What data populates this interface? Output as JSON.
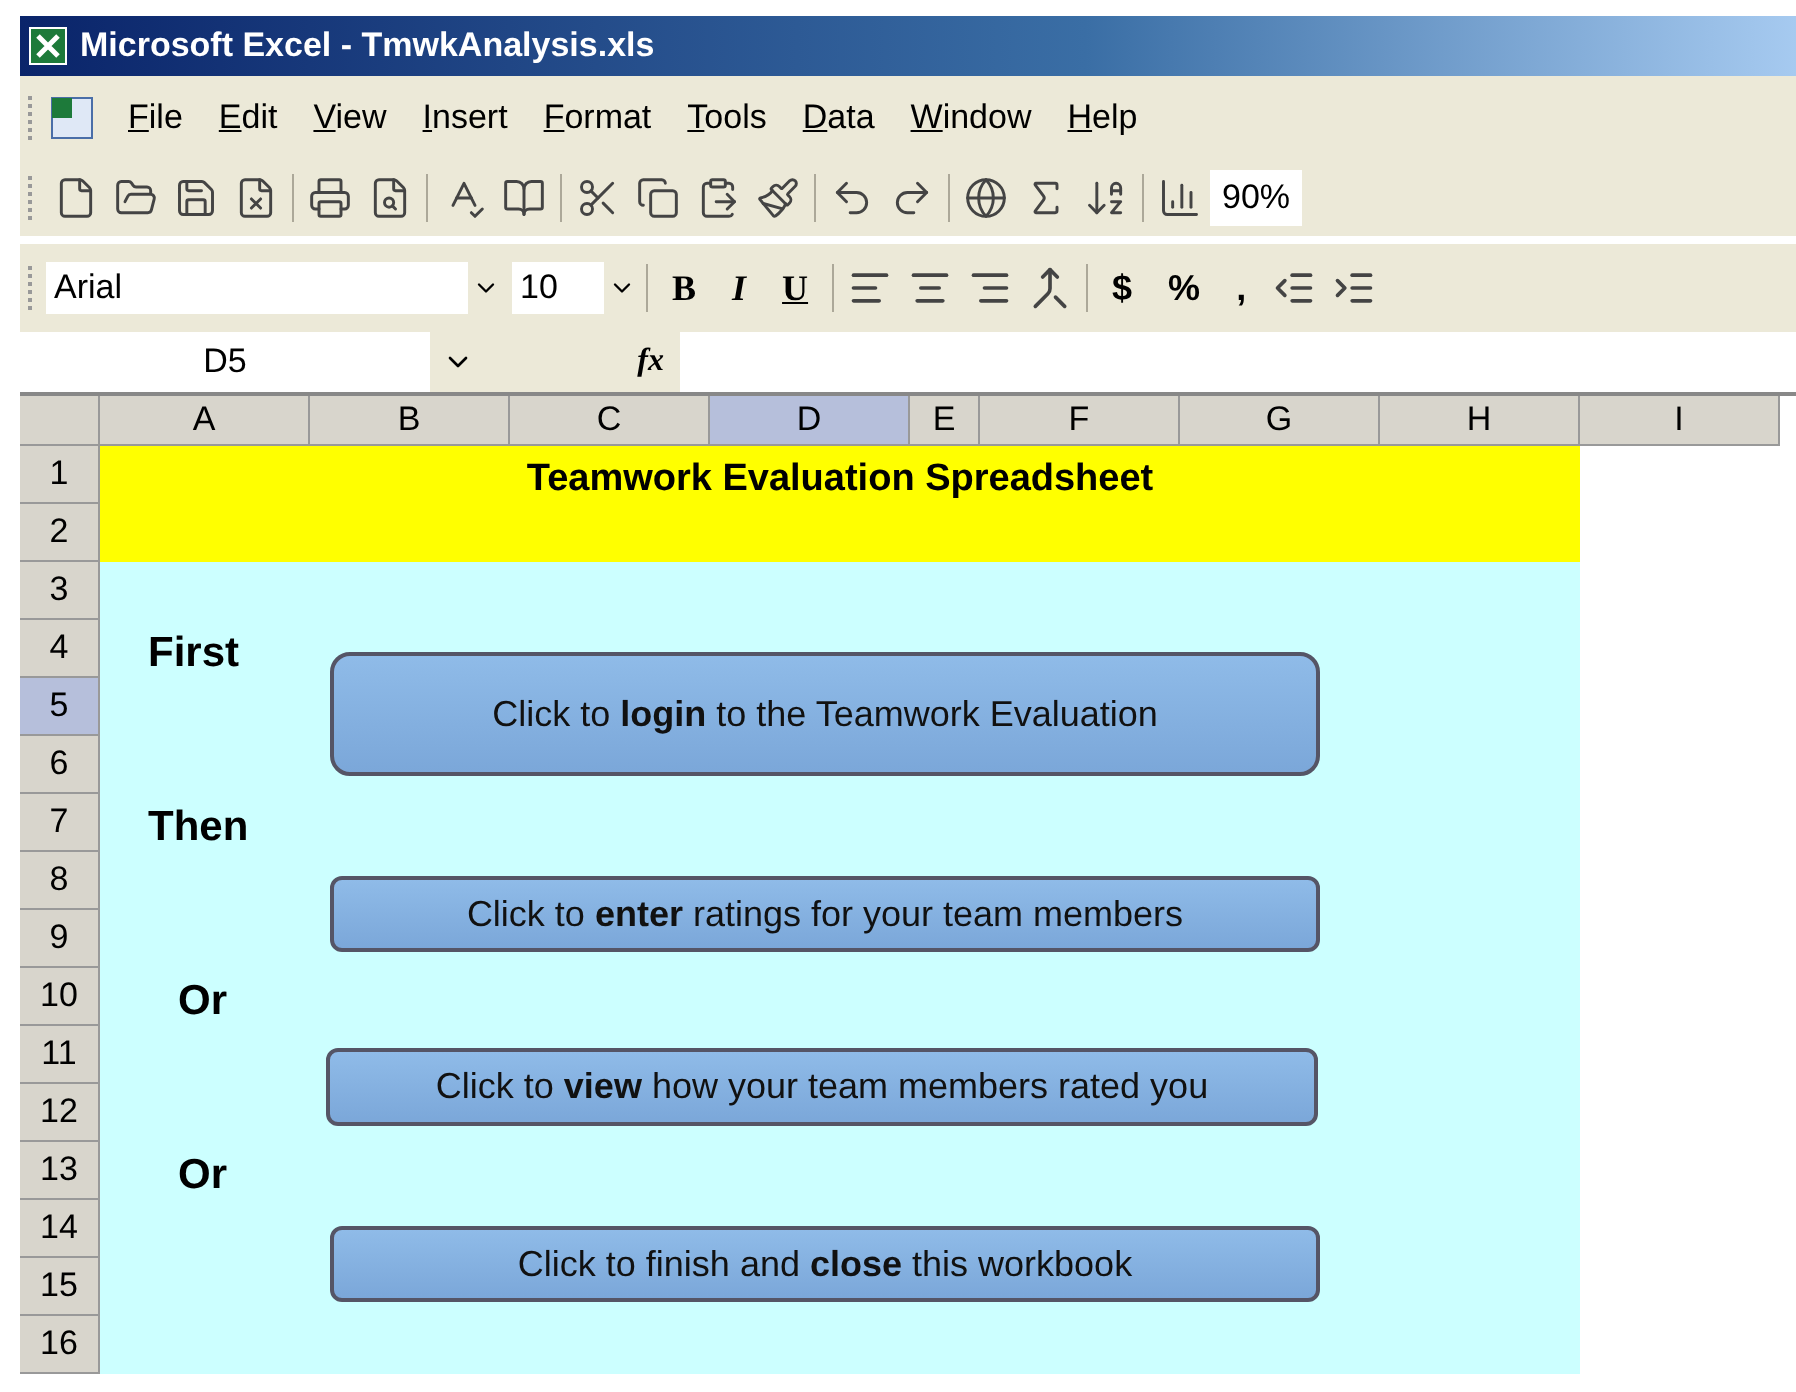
{
  "window": {
    "title": "Microsoft Excel - TmwkAnalysis.xls"
  },
  "menu": [
    {
      "label": "File"
    },
    {
      "label": "Edit"
    },
    {
      "label": "View"
    },
    {
      "label": "Insert"
    },
    {
      "label": "Format"
    },
    {
      "label": "Tools"
    },
    {
      "label": "Data"
    },
    {
      "label": "Window"
    },
    {
      "label": "Help"
    }
  ],
  "toolbar": {
    "zoom": "90%"
  },
  "format_bar": {
    "font": "Arial",
    "size": "10",
    "style_buttons": [
      "B",
      "I",
      "U"
    ],
    "number_buttons": [
      "$",
      "%",
      ","
    ]
  },
  "formula_bar": {
    "name_box": "D5",
    "fx": "fx"
  },
  "columns": [
    {
      "label": "A",
      "selected": false
    },
    {
      "label": "B",
      "selected": false
    },
    {
      "label": "C",
      "selected": false
    },
    {
      "label": "D",
      "selected": true
    },
    {
      "label": "E",
      "selected": false
    },
    {
      "label": "F",
      "selected": false
    },
    {
      "label": "G",
      "selected": false
    },
    {
      "label": "H",
      "selected": false
    },
    {
      "label": "I",
      "selected": false
    }
  ],
  "rows": [
    {
      "label": "1",
      "selected": false
    },
    {
      "label": "2",
      "selected": false
    },
    {
      "label": "3",
      "selected": false
    },
    {
      "label": "4",
      "selected": false
    },
    {
      "label": "5",
      "selected": true
    },
    {
      "label": "6",
      "selected": false
    },
    {
      "label": "7",
      "selected": false
    },
    {
      "label": "8",
      "selected": false
    },
    {
      "label": "9",
      "selected": false
    },
    {
      "label": "10",
      "selected": false
    },
    {
      "label": "11",
      "selected": false
    },
    {
      "label": "12",
      "selected": false
    },
    {
      "label": "13",
      "selected": false
    },
    {
      "label": "14",
      "selected": false
    },
    {
      "label": "15",
      "selected": false
    },
    {
      "label": "16",
      "selected": false
    }
  ],
  "sheet": {
    "title": "Teamwork Evaluation Spreadsheet",
    "labels": [
      "First",
      "Then",
      "Or",
      "Or"
    ],
    "buttons": [
      "Click to **login** to the Teamwork Evaluation",
      "Click to **enter** ratings for your team members",
      "Click to **view** how your team members rated you",
      "Click to finish and **close** this workbook"
    ]
  }
}
